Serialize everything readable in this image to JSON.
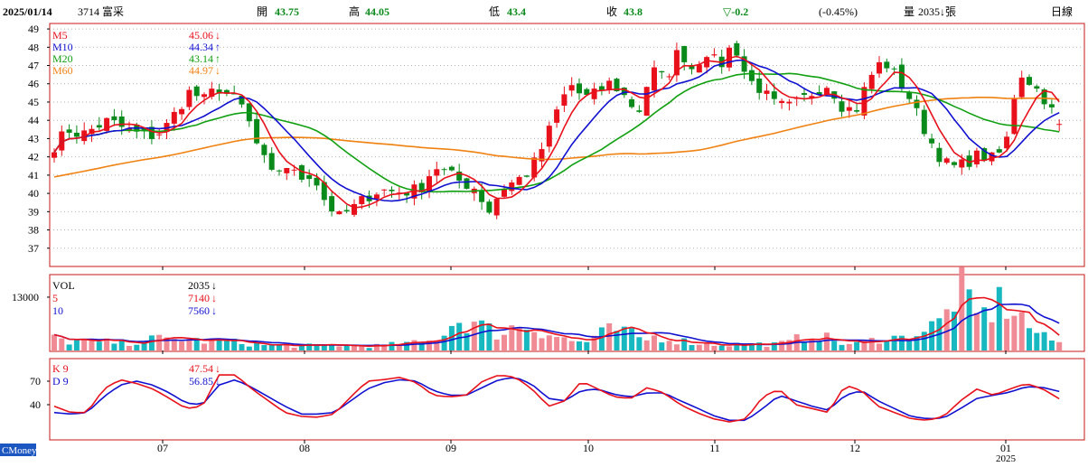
{
  "header": {
    "date": "2025/01/14",
    "stock": "3714 富采",
    "open_label": "開",
    "open": "43.75",
    "high_label": "高",
    "high": "44.05",
    "low_label": "低",
    "low": "43.4",
    "close_label": "收",
    "close": "43.8",
    "change": "▽-0.2",
    "change_pct": "(-0.45%)",
    "volume_label": "量",
    "volume": "2035↓張",
    "period": "日線"
  },
  "colors": {
    "up": "#e8101a",
    "down": "#0a8a1a",
    "ma5": "#e8101a",
    "ma10": "#1010d0",
    "ma20": "#10a010",
    "ma60": "#f08010",
    "vol_up": "#f08a94",
    "vol_down": "#18b8c0",
    "k_line": "#e8101a",
    "d_line": "#1010d0",
    "frame": "#c81818",
    "grid": "#b0b0b0"
  },
  "price_panel": {
    "y_ticks": [
      "49",
      "48",
      "47",
      "46",
      "45",
      "44",
      "43",
      "42",
      "41",
      "40",
      "39",
      "38",
      "37"
    ],
    "legend": [
      {
        "name": "M5",
        "value": "45.06",
        "arrow": "↓"
      },
      {
        "name": "M10",
        "value": "44.34",
        "arrow": "↑"
      },
      {
        "name": "M20",
        "value": "43.14",
        "arrow": "↑"
      },
      {
        "name": "M60",
        "value": "44.97",
        "arrow": "↓"
      }
    ]
  },
  "volume_panel": {
    "y_tick": "13000",
    "legend": [
      {
        "name": "VOL",
        "value": "2035",
        "arrow": "↓"
      },
      {
        "name": "5",
        "value": "7140",
        "arrow": "↓"
      },
      {
        "name": "10",
        "value": "7560",
        "arrow": "↓"
      }
    ]
  },
  "kd_panel": {
    "y_ticks": [
      "70",
      "40"
    ],
    "legend": [
      {
        "name": "K 9",
        "value": "47.54",
        "arrow": "↓"
      },
      {
        "name": "D 9",
        "value": "56.85",
        "arrow": "↓"
      }
    ]
  },
  "x_axis": {
    "months": [
      "07",
      "08",
      "09",
      "10",
      "11",
      "12",
      "01"
    ],
    "year": "2025"
  },
  "watermark": "CMoney",
  "chart_data": {
    "type": "candlestick",
    "ylim": [
      36,
      49.3
    ],
    "close_anchors": [
      42.6,
      43.5,
      43.2,
      43.6,
      44.0,
      43.6,
      43.3,
      43.1,
      43.4,
      44.5,
      45.6,
      45.1,
      45.8,
      45.3,
      44.6,
      42.5,
      41.0,
      41.6,
      40.8,
      41.1,
      39.5,
      38.7,
      39.2,
      39.8,
      40.2,
      40.1,
      40.1,
      40.3,
      41.5,
      41.1,
      40.6,
      40.3,
      39.0,
      40.3,
      40.7,
      41.2,
      42.6,
      44.5,
      46.0,
      45.2,
      45.5,
      46.1,
      45.3,
      44.4,
      46.8,
      46.2,
      47.9,
      46.8,
      47.8,
      46.9,
      48.3,
      46.3,
      45.7,
      44.9,
      44.7,
      45.1,
      45.6,
      46.0,
      44.8,
      44.5,
      46.3,
      47.3,
      46.4,
      45.2,
      43.6,
      42.2,
      41.4,
      41.6,
      42.1,
      41.9,
      42.4,
      46.7,
      46.0,
      45.1,
      43.8
    ],
    "volume_anchors": [
      2900,
      2200,
      2300,
      2000,
      2100,
      1800,
      2300,
      2900,
      2600,
      2900,
      2400,
      2200,
      2200,
      1900,
      1500,
      1200,
      1200,
      1100,
      1200,
      1100,
      1400,
      1000,
      1100,
      1300,
      1600,
      1800,
      1900,
      4200,
      7200,
      7000,
      5500,
      4000,
      5800,
      6100,
      4800,
      3500,
      2300,
      2000,
      4000,
      5100,
      4200,
      2400,
      3500,
      2800,
      2200,
      1800,
      1500,
      1500,
      1500,
      1600,
      1500,
      1800,
      3200,
      4000,
      2800,
      1500,
      1600,
      2500,
      3600,
      2900,
      4200,
      5500,
      7500,
      16500,
      8000,
      9000,
      12000,
      9500,
      5500,
      3000,
      2035
    ],
    "k_anchors": [
      38,
      30,
      30,
      60,
      72,
      67,
      60,
      48,
      35,
      38,
      78,
      78,
      60,
      45,
      30,
      25,
      24,
      28,
      50,
      70,
      72,
      75,
      68,
      52,
      50,
      52,
      70,
      78,
      75,
      60,
      38,
      45,
      70,
      60,
      50,
      48,
      62,
      55,
      40,
      30,
      22,
      18,
      22,
      50,
      60,
      40,
      35,
      30,
      65,
      58,
      38,
      30,
      22,
      20,
      25,
      45,
      60,
      52,
      60,
      67,
      60,
      47.54
    ],
    "d_anchors": [
      30,
      28,
      30,
      50,
      65,
      70,
      65,
      55,
      42,
      40,
      65,
      72,
      62,
      50,
      38,
      28,
      28,
      30,
      45,
      60,
      68,
      72,
      70,
      58,
      52,
      52,
      62,
      72,
      75,
      66,
      48,
      45,
      58,
      60,
      53,
      50,
      55,
      55,
      45,
      36,
      26,
      20,
      20,
      35,
      52,
      45,
      38,
      33,
      52,
      58,
      45,
      35,
      25,
      22,
      23,
      35,
      48,
      52,
      56,
      63,
      62,
      56.85
    ]
  }
}
